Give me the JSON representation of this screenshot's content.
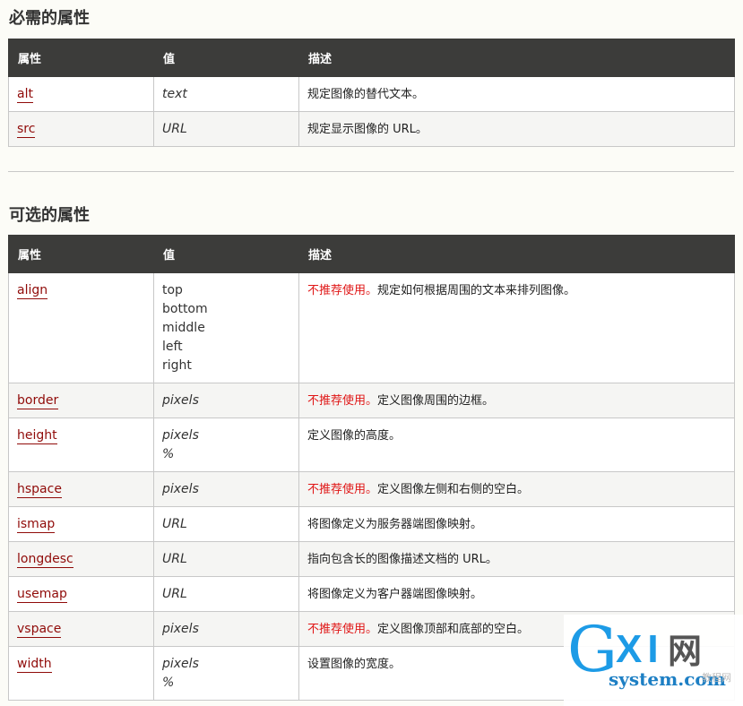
{
  "required": {
    "heading": "必需的属性",
    "headers": [
      "属性",
      "值",
      "描述"
    ],
    "rows": [
      {
        "attr": "alt",
        "values": [
          "text"
        ],
        "desc": "规定图像的替代文本。"
      },
      {
        "attr": "src",
        "values": [
          "URL"
        ],
        "desc": "规定显示图像的 URL。"
      }
    ]
  },
  "optional": {
    "heading": "可选的属性",
    "headers": [
      "属性",
      "值",
      "描述"
    ],
    "deprecated_label": "不推荐使用。",
    "rows": [
      {
        "attr": "align",
        "values": [
          "top",
          "bottom",
          "middle",
          "left",
          "right"
        ],
        "deprecated": true,
        "desc": "规定如何根据周围的文本来排列图像。"
      },
      {
        "attr": "border",
        "values": [
          "pixels"
        ],
        "deprecated": true,
        "desc": "定义图像周围的边框。"
      },
      {
        "attr": "height",
        "values": [
          "pixels",
          "%"
        ],
        "desc": "定义图像的高度。"
      },
      {
        "attr": "hspace",
        "values": [
          "pixels"
        ],
        "deprecated": true,
        "desc": "定义图像左侧和右侧的空白。"
      },
      {
        "attr": "ismap",
        "values": [
          "URL"
        ],
        "desc": "将图像定义为服务器端图像映射。"
      },
      {
        "attr": "longdesc",
        "values": [
          "URL"
        ],
        "desc": "指向包含长的图像描述文档的 URL。"
      },
      {
        "attr": "usemap",
        "values": [
          "URL"
        ],
        "desc": "将图像定义为客户器端图像映射。"
      },
      {
        "attr": "vspace",
        "values": [
          "pixels"
        ],
        "deprecated": true,
        "desc": "定义图像顶部和底部的空白。"
      },
      {
        "attr": "width",
        "values": [
          "pixels",
          "%"
        ],
        "desc": "设置图像的宽度。"
      }
    ]
  },
  "watermark": {
    "g": "G",
    "xi": "XI",
    "cn": "网",
    "domain": "system.com",
    "sub": "教程网"
  },
  "colors": {
    "header_bg": "#3c3c3a",
    "link": "#900b09",
    "deprecated": "#e01616",
    "watermark_blue": "#1d9be6"
  }
}
